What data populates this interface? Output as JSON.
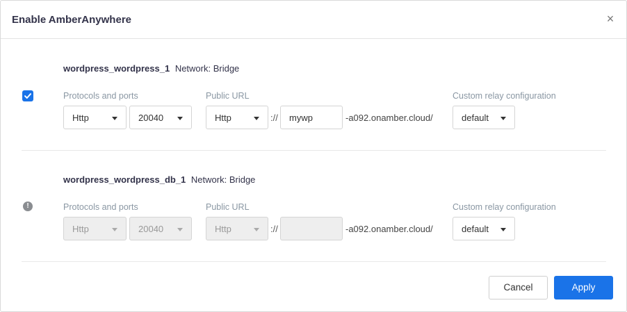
{
  "dialog": {
    "title": "Enable AmberAnywhere",
    "close_glyph": "×",
    "icons": {
      "close": "close-icon",
      "check": "check-icon",
      "warning": "info-warning-icon"
    },
    "accent_color": "#1a73e8"
  },
  "labels": {
    "protocols": "Protocols and ports",
    "public_url": "Public URL",
    "relay": "Custom relay configuration",
    "separator": "://"
  },
  "rows": [
    {
      "name": "wordpress_wordpress_1",
      "network": "Network: Bridge",
      "checked": true,
      "protocol": "Http",
      "port": "20040",
      "url_protocol": "Http",
      "subdomain": "mywp",
      "suffix": "-a092.onamber.cloud/",
      "relay": "default"
    },
    {
      "name": "wordpress_wordpress_db_1",
      "network": "Network: Bridge",
      "checked": false,
      "protocol": "Http",
      "port": "20040",
      "url_protocol": "Http",
      "subdomain": "",
      "suffix": "-a092.onamber.cloud/",
      "relay": "default"
    }
  ],
  "footer": {
    "cancel_label": "Cancel",
    "apply_label": "Apply"
  }
}
